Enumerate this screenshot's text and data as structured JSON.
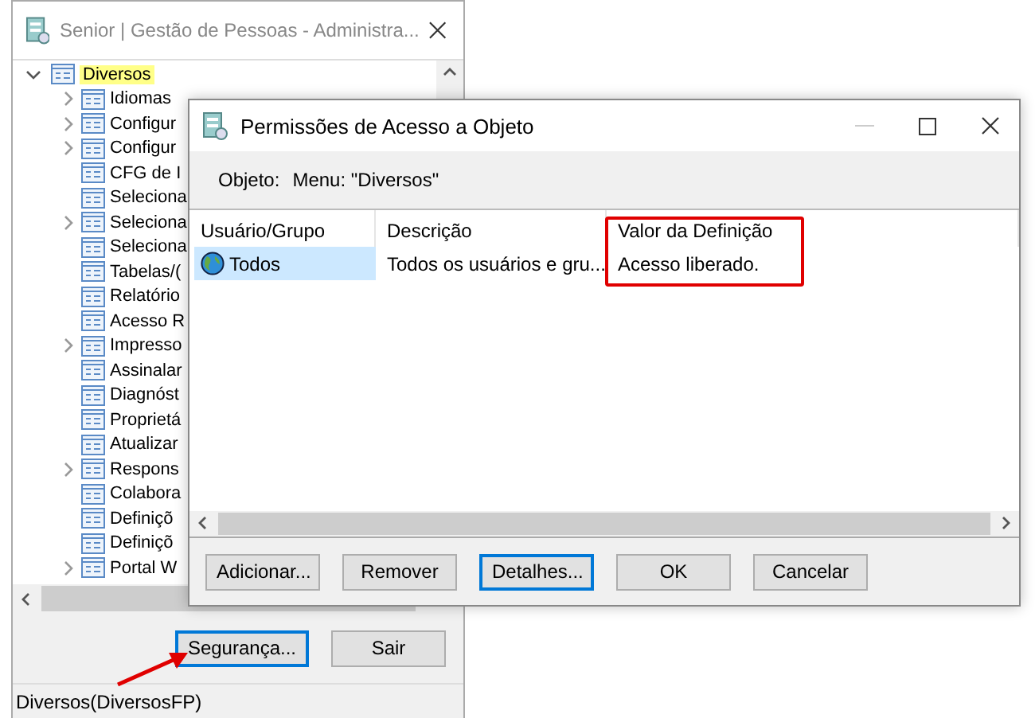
{
  "main_window": {
    "title": "Senior | Gestão de Pessoas - Administra...",
    "tree": [
      {
        "label": "Diversos",
        "expanded": true,
        "selected": true,
        "children": [
          {
            "label": "Idiomas",
            "expandable": true,
            "selected": false
          },
          {
            "label": "Configur",
            "expandable": true,
            "selected": false
          },
          {
            "label": "Configur",
            "expandable": true,
            "selected": false
          },
          {
            "label": "CFG de I",
            "expandable": false,
            "selected": false
          },
          {
            "label": "Seleciona",
            "expandable": false,
            "selected": false
          },
          {
            "label": "Seleciona",
            "expandable": true,
            "selected": false
          },
          {
            "label": "Seleciona",
            "expandable": false,
            "selected": false
          },
          {
            "label": "Tabelas/(",
            "expandable": false,
            "selected": false
          },
          {
            "label": "Relatório",
            "expandable": false,
            "selected": false
          },
          {
            "label": "Acesso R",
            "expandable": false,
            "selected": false
          },
          {
            "label": "Impresso",
            "expandable": true,
            "selected": false
          },
          {
            "label": "Assinalar",
            "expandable": false,
            "selected": false
          },
          {
            "label": "Diagnóst",
            "expandable": false,
            "selected": false
          },
          {
            "label": "Proprietá",
            "expandable": false,
            "selected": false
          },
          {
            "label": "Atualizar",
            "expandable": false,
            "selected": false
          },
          {
            "label": "Respons",
            "expandable": true,
            "selected": false
          },
          {
            "label": "Colabora",
            "expandable": false,
            "selected": false
          },
          {
            "label": "Definiçõ",
            "expandable": false,
            "selected": false
          },
          {
            "label": "Definiçõ",
            "expandable": false,
            "selected": false
          },
          {
            "label": "Portal W",
            "expandable": true,
            "selected": false
          }
        ]
      }
    ],
    "buttons": [
      {
        "label": "Segurança...",
        "focused": true
      },
      {
        "label": "Sair",
        "focused": false
      }
    ],
    "status_bar": "Diversos(DiversosFP)"
  },
  "dialog": {
    "title": "Permissões de Acesso a Objeto",
    "object_label": "Objeto:",
    "object_value": "Menu: \"Diversos\"",
    "columns": [
      "Usuário/Grupo",
      "Descrição",
      "Valor da Definição"
    ],
    "rows": [
      {
        "cells": [
          "Todos",
          "Todos os usuários e gru...",
          "Acesso liberado."
        ],
        "selected": true
      }
    ],
    "buttons": [
      {
        "label": "Adicionar...",
        "focused": false
      },
      {
        "label": "Remover",
        "focused": false
      },
      {
        "label": "Detalhes...",
        "focused": true
      },
      {
        "label": "OK",
        "focused": false
      },
      {
        "label": "Cancelar",
        "focused": false
      }
    ]
  }
}
